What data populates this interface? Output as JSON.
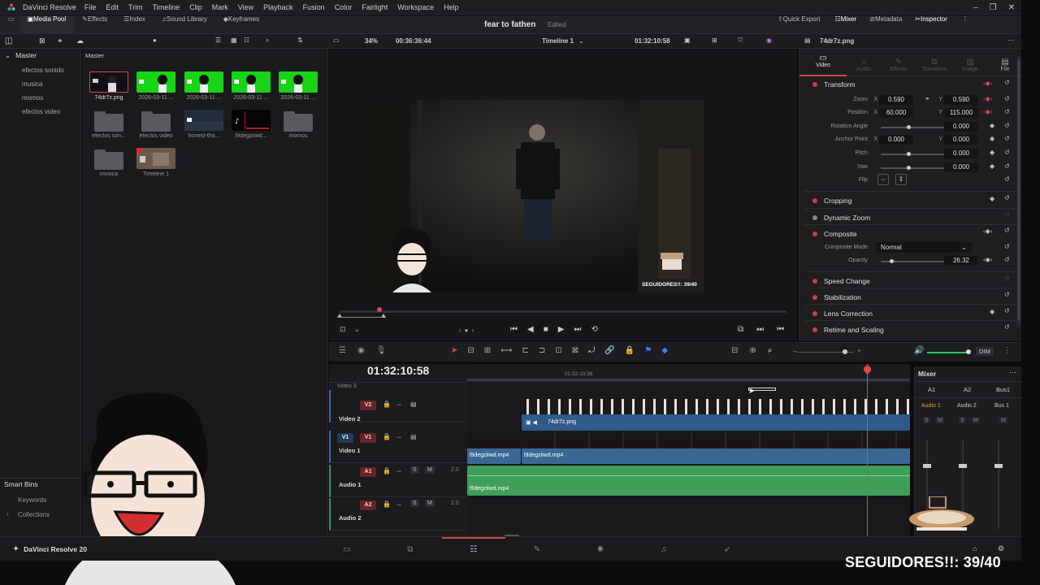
{
  "app": {
    "title": "DaVinci Resolve",
    "menus": [
      "File",
      "Edit",
      "Trim",
      "Timeline",
      "Clip",
      "Mark",
      "View",
      "Playback",
      "Fusion",
      "Color",
      "Fairlight",
      "Workspace",
      "Help"
    ]
  },
  "toolbar": {
    "media_pool": "Media Pool",
    "effects": "Effects",
    "index": "Index",
    "sound_library": "Sound Library",
    "keyframes": "Keyframes",
    "project_title": "fear to fathen",
    "edited": "Edited",
    "quick_export": "Quick Export",
    "mixer": "Mixer",
    "metadata": "Metadata",
    "inspector": "Inspector"
  },
  "subbar": {
    "zoom": "34%",
    "source_timecode": "00:36:36:44",
    "timeline_name": "Timeline 1",
    "record_timecode": "01:32:10:58",
    "clip_name": "74dr7z.png"
  },
  "bins": {
    "master": "Master",
    "items": [
      "efectos sonido",
      "musica",
      "momos",
      "efectos video"
    ],
    "smart_bins": "Smart Bins",
    "smart_items": [
      "Keywords",
      "Collections"
    ]
  },
  "media_pool": {
    "header": "Master",
    "clips": [
      {
        "label": "74dr7z.png"
      },
      {
        "label": "2026-03-11 ..."
      },
      {
        "label": "2026-03-11 ..."
      },
      {
        "label": "2026-03-11 ..."
      },
      {
        "label": "2026-03-11 ..."
      },
      {
        "label": "efectos son..."
      },
      {
        "label": "efectos video"
      },
      {
        "label": "honest-tho..."
      },
      {
        "label": "l9degziiwd..."
      },
      {
        "label": "momos"
      },
      {
        "label": "musica"
      },
      {
        "label": "Timeline 1"
      }
    ]
  },
  "viewer": {
    "overlay_text": "SEGUIDORES!!: 39/40"
  },
  "inspector": {
    "tabs": [
      "Video",
      "Audio",
      "Effects",
      "Transition",
      "Image",
      "File"
    ],
    "transform": "Transform",
    "zoom_label": "Zoom",
    "zoom_x": "0.590",
    "zoom_y": "0.590",
    "position_label": "Position",
    "position_x": "60.000",
    "position_y": "115.000",
    "rotation_label": "Rotation Angle",
    "rotation": "0.000",
    "anchor_label": "Anchor Point",
    "anchor_x": "0.000",
    "anchor_y": "0.000",
    "pitch_label": "Pitch",
    "pitch": "0.000",
    "yaw_label": "Yaw",
    "yaw": "0.000",
    "flip_label": "Flip",
    "cropping": "Cropping",
    "dynamic_zoom": "Dynamic Zoom",
    "composite": "Composite",
    "composite_mode_label": "Composite Mode",
    "composite_mode": "Normal",
    "opacity_label": "Opacity",
    "opacity": "26.32",
    "speed_change": "Speed Change",
    "stabilization": "Stabilization",
    "lens_correction": "Lens Correction",
    "retime_scaling": "Retime and Scaling",
    "x": "X",
    "y": "Y"
  },
  "timeline": {
    "timecode": "01:32:10:58",
    "ruler_tc": "01:32:10:36",
    "dim": "DIM",
    "tracks": {
      "v2_badge": "V2",
      "v2_name": "Video 2",
      "v1_badge": "V1",
      "v1_src": "V1",
      "v1_name": "Video 1",
      "a1_badge": "A1",
      "a1_name": "Audio 1",
      "a1_level": "2.0",
      "a2_badge": "A2",
      "a2_name": "Audio 2",
      "a2_level": "2.0",
      "s": "S",
      "m": "M",
      "top_name": "Video 3"
    },
    "clips": {
      "v2": "74dr7z.png",
      "v1a": "l9degziiwd.mp4",
      "v1b": "l9degziiwd.mp4",
      "a1": "l9degziiwd.mp4"
    }
  },
  "mixer": {
    "title": "Mixer",
    "cols": [
      "A1",
      "A2",
      "Bus1"
    ],
    "names": [
      "Audio 1",
      "Audio 2",
      "Bus 1"
    ]
  },
  "bottom": {
    "brand": "DaVinci Resolve 20",
    "overlay": "SEGUIDORES!!: 39/40"
  }
}
